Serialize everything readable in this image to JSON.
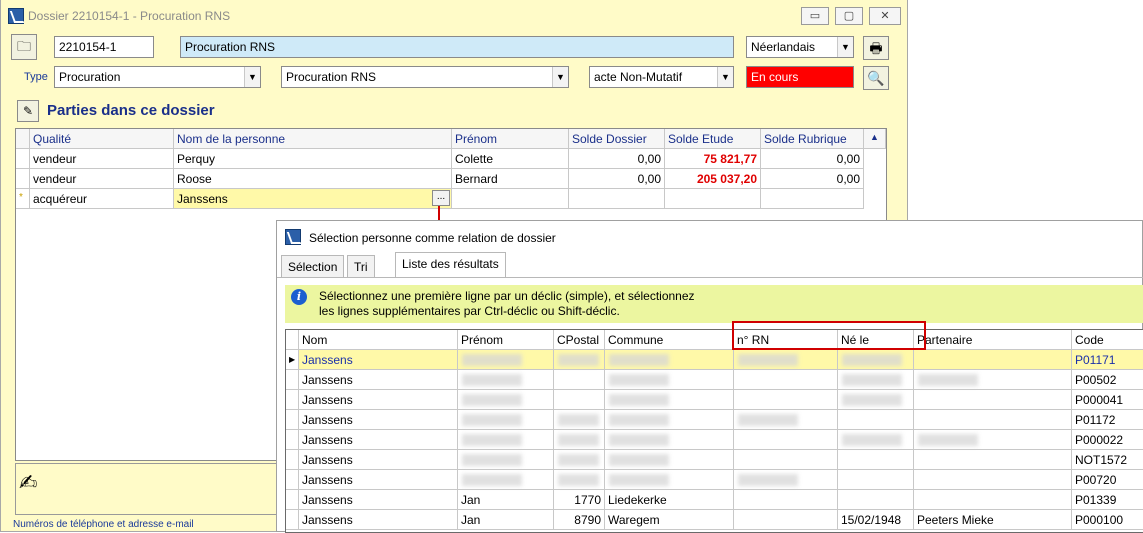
{
  "window": {
    "title": "Dossier 2210154-1 - Procuration RNS",
    "controls": {
      "minimize": "▭",
      "maximize": "▢",
      "close": "✕"
    }
  },
  "header": {
    "dossier_number": "2210154-1",
    "dossier_title": "Procuration RNS",
    "language": "Néerlandais",
    "type_label": "Type",
    "type_value": "Procuration",
    "subtype_value": "Procuration RNS",
    "acte_value": "acte Non-Mutatif",
    "status": "En cours"
  },
  "parties": {
    "title": "Parties dans ce dossier",
    "columns": [
      "Qualité",
      "Nom de la personne",
      "Prénom",
      "Solde Dossier",
      "Solde Etude",
      "Solde Rubrique"
    ],
    "rows": [
      {
        "qualite": "vendeur",
        "nom": "Perquy",
        "prenom": "Colette",
        "solde_dossier": "0,00",
        "solde_etude": "75 821,77",
        "solde_rubrique": "0,00"
      },
      {
        "qualite": "vendeur",
        "nom": "Roose",
        "prenom": "Bernard",
        "solde_dossier": "0,00",
        "solde_etude": "205 037,20",
        "solde_rubrique": "0,00"
      },
      {
        "marker": "*",
        "qualite": "acquéreur",
        "nom": "Janssens",
        "prenom": "",
        "solde_dossier": "",
        "solde_etude": "",
        "solde_rubrique": "",
        "ellipsis": "..."
      }
    ]
  },
  "footer": {
    "text": "Numéros de téléphone et adresse e-mail"
  },
  "dialog": {
    "title": "Sélection personne comme relation de dossier",
    "tabs": [
      "Sélection",
      "Tri",
      "Liste des résultats"
    ],
    "info_line1": "Sélectionnez une première ligne par un déclic (simple), et sélectionnez",
    "info_line2": "les lignes supplémentaires par Ctrl-déclic ou Shift-déclic.",
    "columns": [
      "Nom",
      "Prénom",
      "CPostal",
      "Commune",
      "n° RN",
      "Né le",
      "Partenaire",
      "Code"
    ],
    "rows": [
      {
        "nom": "Janssens",
        "prenom": "",
        "cpostal": "",
        "commune": "",
        "rn": "",
        "nele": "",
        "partenaire": "",
        "code": "P01171"
      },
      {
        "nom": "Janssens",
        "prenom": "",
        "cpostal": "",
        "commune": "",
        "rn": "",
        "nele": "",
        "partenaire": "",
        "code": "P00502"
      },
      {
        "nom": "Janssens",
        "prenom": "",
        "cpostal": "",
        "commune": "",
        "rn": "",
        "nele": "",
        "partenaire": "",
        "code": "P000041"
      },
      {
        "nom": "Janssens",
        "prenom": "",
        "cpostal": "",
        "commune": "",
        "rn": "",
        "nele": "",
        "partenaire": "",
        "code": "P01172"
      },
      {
        "nom": "Janssens",
        "prenom": "",
        "cpostal": "",
        "commune": "",
        "rn": "",
        "nele": "",
        "partenaire": "",
        "code": "P000022"
      },
      {
        "nom": "Janssens",
        "prenom": "",
        "cpostal": "",
        "commune": "",
        "rn": "",
        "nele": "",
        "partenaire": "",
        "code": "NOT1572"
      },
      {
        "nom": "Janssens",
        "prenom": "",
        "cpostal": "",
        "commune": "",
        "rn": "",
        "nele": "",
        "partenaire": "",
        "code": "P00720"
      },
      {
        "nom": "Janssens",
        "prenom": "Jan",
        "cpostal": "1770",
        "commune": "Liedekerke",
        "rn": "",
        "nele": "",
        "partenaire": "",
        "code": "P01339"
      },
      {
        "nom": "Janssens",
        "prenom": "Jan",
        "cpostal": "8790",
        "commune": "Waregem",
        "rn": "",
        "nele": "15/02/1948",
        "partenaire": "Peeters Mieke",
        "code": "P000100"
      }
    ]
  }
}
